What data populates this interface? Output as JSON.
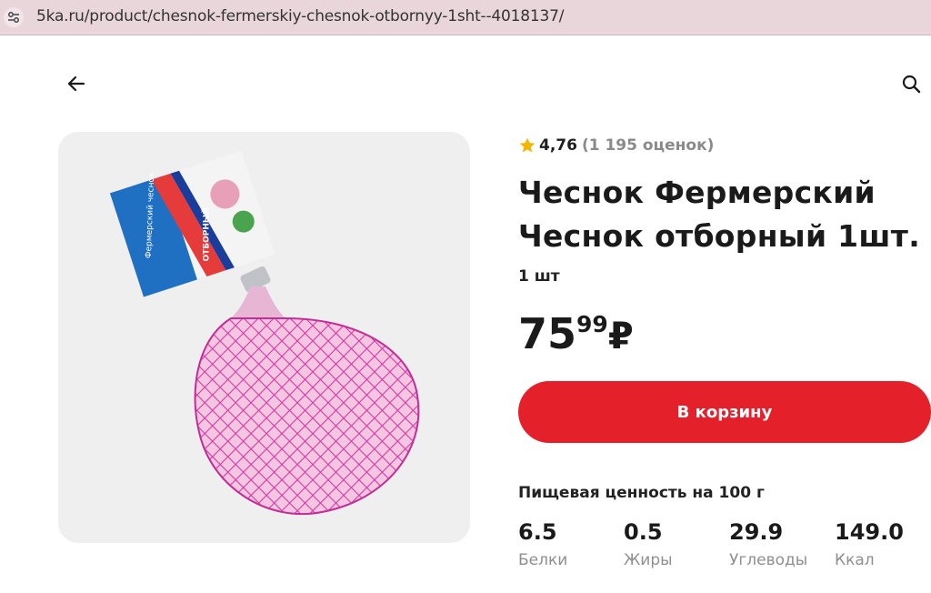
{
  "browser": {
    "url": "5ka.ru/product/chesnok-fermerskiy-chesnok-otbornyy-1sht--4018137/"
  },
  "nav": {
    "back_icon": "arrow-left-icon",
    "search_icon": "search-icon"
  },
  "product": {
    "rating_value": "4,76",
    "rating_count": "(1 195 оценок)",
    "title": "Чеснок Фермерский Чеснок отборный 1шт.",
    "unit": "1 шт",
    "price_int": "75",
    "price_frac": "99",
    "currency": "₽",
    "cart_label": "В корзину",
    "image_alt": "garlic-in-pink-net-bag",
    "package_label_text": "Фермерский чеснок",
    "package_band_text": "ОТБОРНЫЙ"
  },
  "nutrition": {
    "title": "Пищевая ценность на 100 г",
    "items": [
      {
        "value": "6.5",
        "label": "Белки"
      },
      {
        "value": "0.5",
        "label": "Жиры"
      },
      {
        "value": "29.9",
        "label": "Углеводы"
      },
      {
        "value": "149.0",
        "label": "Ккал"
      }
    ]
  },
  "colors": {
    "accent": "#e4202b",
    "star": "#f5b400",
    "muted": "#8f8f8f",
    "card_bg": "#efefef"
  }
}
